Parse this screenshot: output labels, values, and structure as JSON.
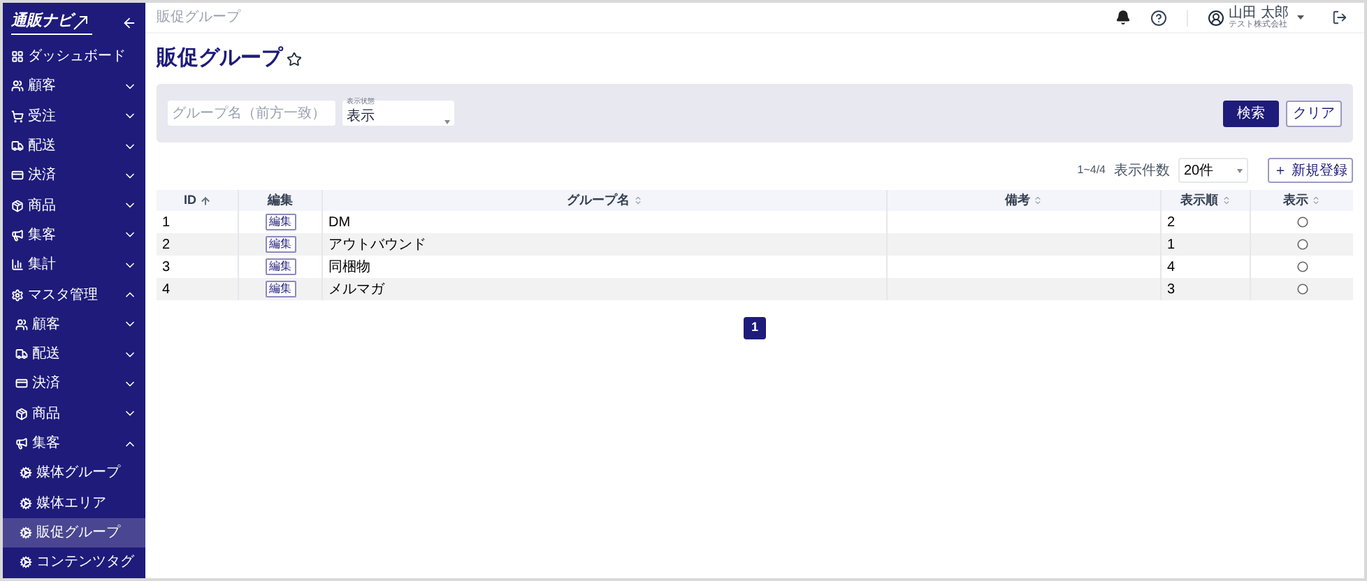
{
  "sidebar": {
    "logo": "通販ナビ",
    "items": [
      {
        "label": "ダッシュボード",
        "kind": "link",
        "selected": false
      },
      {
        "label": "顧客",
        "kind": "group",
        "expanded": false
      },
      {
        "label": "受注",
        "kind": "group",
        "expanded": false
      },
      {
        "label": "配送",
        "kind": "group",
        "expanded": false
      },
      {
        "label": "決済",
        "kind": "group",
        "expanded": false
      },
      {
        "label": "商品",
        "kind": "group",
        "expanded": false
      },
      {
        "label": "集客",
        "kind": "group",
        "expanded": false
      },
      {
        "label": "集計",
        "kind": "group",
        "expanded": false
      },
      {
        "label": "マスタ管理",
        "kind": "group",
        "expanded": true,
        "children": [
          {
            "label": "顧客",
            "kind": "group",
            "expanded": false
          },
          {
            "label": "配送",
            "kind": "group",
            "expanded": false
          },
          {
            "label": "決済",
            "kind": "group",
            "expanded": false
          },
          {
            "label": "商品",
            "kind": "group",
            "expanded": false
          },
          {
            "label": "集客",
            "kind": "group",
            "expanded": true,
            "children": [
              {
                "label": "媒体グループ",
                "kind": "link",
                "selected": false
              },
              {
                "label": "媒体エリア",
                "kind": "link",
                "selected": false
              },
              {
                "label": "販促グループ",
                "kind": "link",
                "selected": true
              },
              {
                "label": "コンテンツタグ",
                "kind": "link",
                "selected": false
              }
            ]
          }
        ]
      }
    ]
  },
  "header": {
    "breadcrumb": "販促グループ",
    "user_name": "山田 太郎",
    "company": "テスト株式会社"
  },
  "page_title": "販促グループ",
  "filters": {
    "name": {
      "placeholder": "グループ名（前方一致）"
    },
    "status": {
      "label": "表示状態",
      "value": "表示"
    },
    "buttons": [
      "検索",
      "クリア"
    ]
  },
  "toolbar": {
    "count": "1~4/4",
    "per_page_label": "表示件数",
    "per_page": "20件",
    "new_button": "＋ 新規登録"
  },
  "table": {
    "columns": [
      {
        "label": "ID",
        "sortable": true,
        "sorted": true
      },
      {
        "label": "編集",
        "sortable": false
      },
      {
        "label": "グループ名",
        "sortable": true,
        "sorted": false
      },
      {
        "label": "備考",
        "sortable": true,
        "sorted": false
      },
      {
        "label": "表示順",
        "sortable": true,
        "sorted": false
      },
      {
        "label": "表示",
        "sortable": true,
        "sorted": false
      }
    ],
    "rows": [
      {
        "id": "1",
        "edit": "編集",
        "name": "DM",
        "order": "2"
      },
      {
        "id": "2",
        "edit": "編集",
        "name": "アウトバウンド",
        "order": "1"
      },
      {
        "id": "3",
        "edit": "編集",
        "name": "同梱物",
        "order": "4"
      },
      {
        "id": "4",
        "edit": "編集",
        "name": "メルマガ",
        "order": "3"
      }
    ]
  },
  "pagination": [
    {
      "label": "1",
      "selected": true
    }
  ]
}
